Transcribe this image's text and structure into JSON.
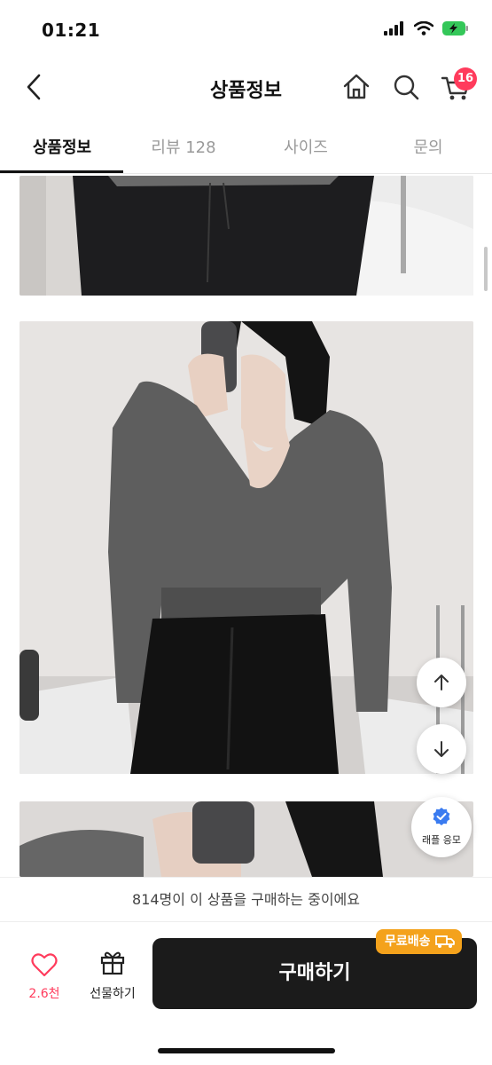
{
  "status_bar": {
    "time": "01:21"
  },
  "header": {
    "title": "상품정보",
    "cart_count": "16"
  },
  "tabs": [
    {
      "label": "상품정보",
      "active": true
    },
    {
      "label": "리뷰 128",
      "active": false
    },
    {
      "label": "사이즈",
      "active": false
    },
    {
      "label": "문의",
      "active": false
    }
  ],
  "product_images": [
    {
      "description": "검정 스커트 하단 이미지"
    },
    {
      "description": "그레이 브이넥 크롭 니트"
    },
    {
      "description": "그레이 니트 셀카 이미지"
    }
  ],
  "floating": {
    "raffle_label": "래플 응모"
  },
  "notice": {
    "text": "814명이 이 상품을 구매하는 중이에요"
  },
  "bottom_bar": {
    "like_count": "2.6천",
    "gift_label": "선물하기",
    "buy_label": "구매하기",
    "free_shipping_label": "무료배송"
  },
  "colors": {
    "accent": "#ff3b5c",
    "buy_button": "#1b1b1b",
    "free_shipping": "#f4a21c"
  }
}
